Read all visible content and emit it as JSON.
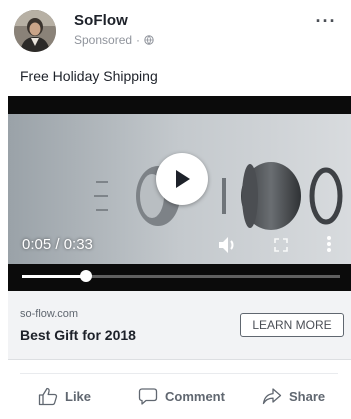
{
  "post": {
    "page_name": "SoFlow",
    "sponsored_label": "Sponsored",
    "separator": "·",
    "more_label": "···",
    "text": "Free Holiday Shipping"
  },
  "video": {
    "current_time": "0:05",
    "duration": "0:33",
    "time_display": "0:05 / 0:33",
    "progress_fraction": 0.2
  },
  "link_card": {
    "domain": "so-flow.com",
    "title": "Best Gift for 2018",
    "cta_label": "LEARN MORE"
  },
  "actions": {
    "like_label": "Like",
    "comment_label": "Comment",
    "share_label": "Share"
  },
  "icons": {
    "avatar": "avatar-portrait",
    "more": "more-dots-icon",
    "globe": "globe-icon",
    "play": "play-icon",
    "volume": "volume-icon",
    "fullscreen": "fullscreen-icon",
    "options": "vertical-dots-icon",
    "like": "thumbs-up-icon",
    "comment": "speech-bubble-icon",
    "share": "share-arrow-icon"
  },
  "colors": {
    "name": "#1d2129",
    "meta": "#90949c",
    "card_bg": "#f2f3f5",
    "action": "#606770",
    "video_bg": "#0b0b0b"
  }
}
